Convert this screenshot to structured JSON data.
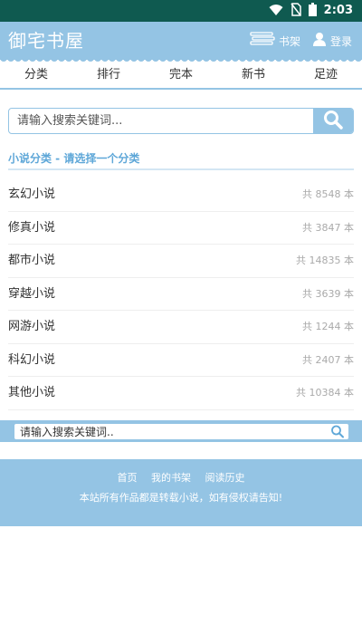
{
  "status_bar": {
    "time": "2:03",
    "icons": [
      "wifi-icon",
      "no-sim-icon",
      "battery-icon"
    ]
  },
  "header": {
    "title": "御宅书屋",
    "bookshelf_label": "书架",
    "login_label": "登录"
  },
  "nav": {
    "items": [
      {
        "label": "分类"
      },
      {
        "label": "排行"
      },
      {
        "label": "完本"
      },
      {
        "label": "新书"
      },
      {
        "label": "足迹"
      }
    ]
  },
  "search": {
    "placeholder": "请输入搜索关键词..."
  },
  "section": {
    "title": "小说分类 - 请选择一个分类"
  },
  "categories": [
    {
      "name": "玄幻小说",
      "count": "共 8548 本"
    },
    {
      "name": "修真小说",
      "count": "共 3847 本"
    },
    {
      "name": "都市小说",
      "count": "共 14835 本"
    },
    {
      "name": "穿越小说",
      "count": "共 3639 本"
    },
    {
      "name": "网游小说",
      "count": "共 1244 本"
    },
    {
      "name": "科幻小说",
      "count": "共 2407 本"
    },
    {
      "name": "其他小说",
      "count": "共 10384 本"
    }
  ],
  "footer_search": {
    "placeholder": "请输入搜索关键词.."
  },
  "footer": {
    "links": [
      {
        "label": "首页"
      },
      {
        "label": "我的书架"
      },
      {
        "label": "阅读历史"
      }
    ],
    "notice": "本站所有作品都是转载小说，如有侵权请告知!"
  },
  "colors": {
    "status_bar": "#0f5a50",
    "brand": "#94c4e4",
    "section_title": "#5ea7d8"
  }
}
